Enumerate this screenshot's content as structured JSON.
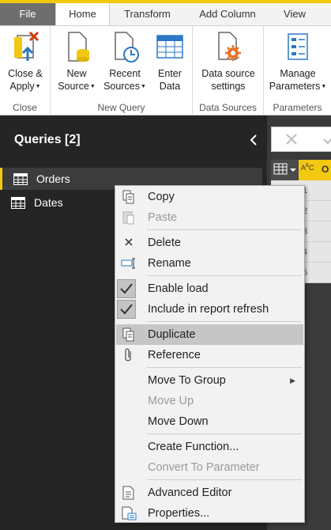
{
  "tabs": [
    "File",
    "Home",
    "Transform",
    "Add Column",
    "View"
  ],
  "ribbon": {
    "groups": {
      "close": "Close",
      "new_query": "New Query",
      "data_sources": "Data Sources",
      "parameters": "Parameters"
    },
    "buttons": {
      "close_apply": [
        "Close &",
        "Apply"
      ],
      "new_source": [
        "New",
        "Source"
      ],
      "recent_sources": [
        "Recent",
        "Sources"
      ],
      "enter_data": [
        "Enter",
        "Data"
      ],
      "data_source_settings": [
        "Data source",
        "settings"
      ],
      "manage_parameters": [
        "Manage",
        "Parameters"
      ]
    }
  },
  "queries": {
    "title": "Queries [2]",
    "items": [
      "Orders",
      "Dates"
    ]
  },
  "grid": {
    "col_header": "O",
    "row_numbers": [
      "1",
      "2",
      "3",
      "4",
      "5"
    ]
  },
  "menu": {
    "copy": "Copy",
    "paste": "Paste",
    "delete": "Delete",
    "rename": "Rename",
    "enable_load": "Enable load",
    "include_refresh": "Include in report refresh",
    "duplicate": "Duplicate",
    "reference": "Reference",
    "move_to_group": "Move To Group",
    "move_up": "Move Up",
    "move_down": "Move Down",
    "create_function": "Create Function...",
    "convert_param": "Convert To Parameter",
    "advanced_editor": "Advanced Editor",
    "properties": "Properties..."
  },
  "colors": {
    "accent": "#f2c811",
    "pane_bg": "#252526",
    "menu_bg": "#f2f2f2",
    "hover": "#c6c6c6"
  }
}
